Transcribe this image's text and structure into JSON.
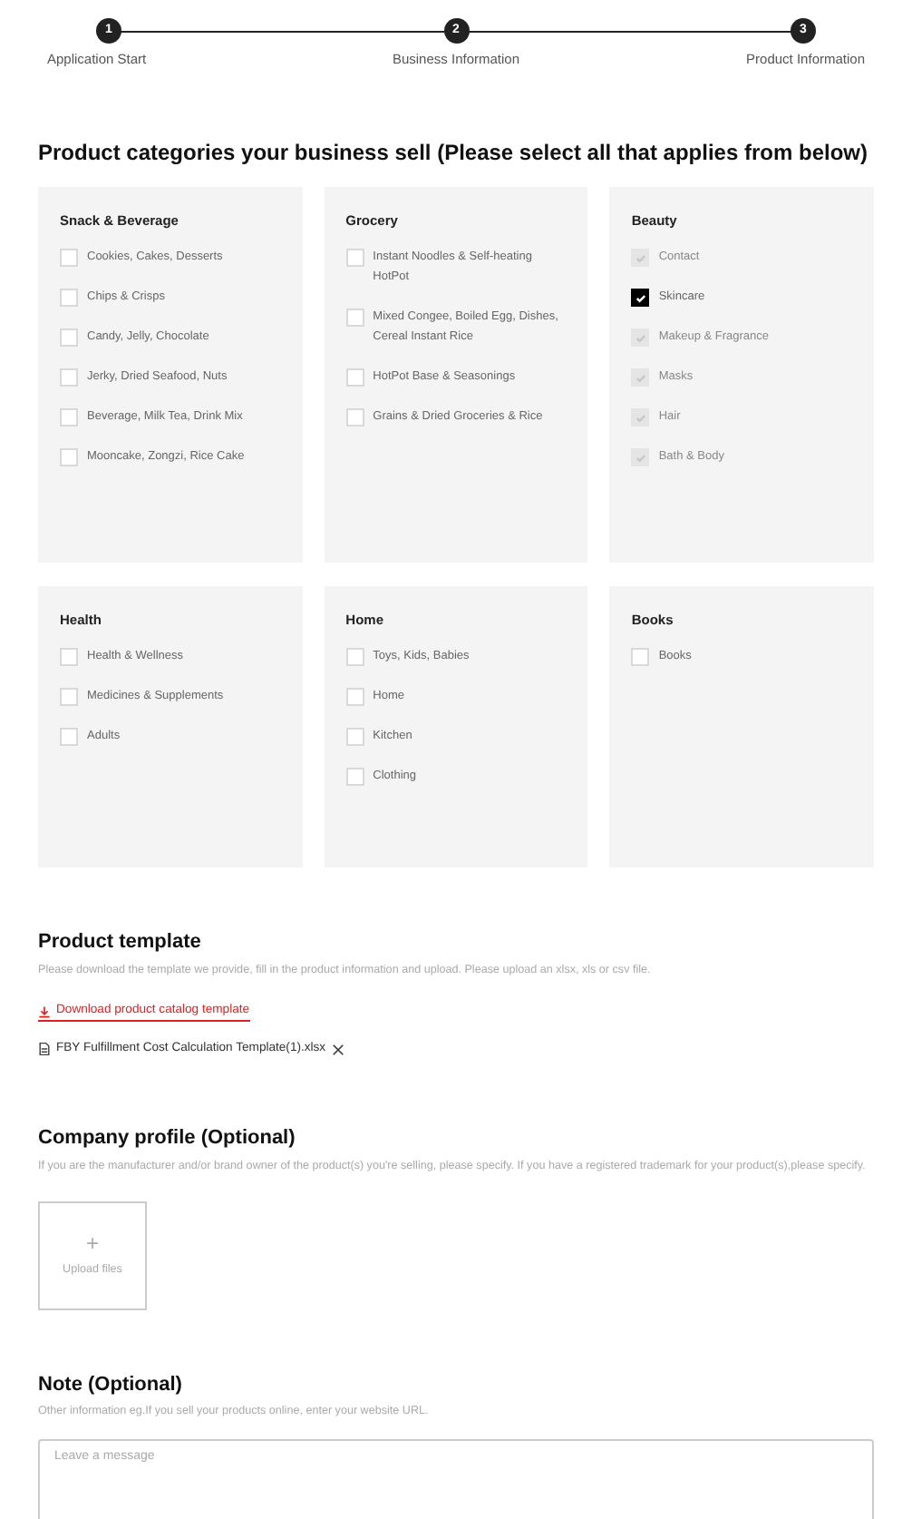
{
  "steps": [
    {
      "number": "1",
      "label": "Application Start"
    },
    {
      "number": "2",
      "label": "Business Information"
    },
    {
      "number": "3",
      "label": "Product Information"
    }
  ],
  "categories": {
    "title": "Product categories your business sell (Please select all that applies from below)",
    "groups": [
      {
        "title": "Snack & Beverage",
        "items": [
          {
            "label": "Cookies, Cakes, Desserts",
            "checked": false,
            "disabled": false
          },
          {
            "label": "Chips & Crisps",
            "checked": false,
            "disabled": false
          },
          {
            "label": "Candy, Jelly, Chocolate",
            "checked": false,
            "disabled": false
          },
          {
            "label": "Jerky, Dried Seafood, Nuts",
            "checked": false,
            "disabled": false
          },
          {
            "label": "Beverage, Milk Tea, Drink Mix",
            "checked": false,
            "disabled": false
          },
          {
            "label": "Mooncake, Zongzi, Rice Cake",
            "checked": false,
            "disabled": false
          }
        ]
      },
      {
        "title": "Grocery",
        "items": [
          {
            "label": "Instant Noodles & Self-heating HotPot",
            "checked": false,
            "disabled": false
          },
          {
            "label": "Mixed Congee, Boiled Egg, Dishes, Cereal Instant Rice",
            "checked": false,
            "disabled": false
          },
          {
            "label": "HotPot Base & Seasonings",
            "checked": false,
            "disabled": false
          },
          {
            "label": "Grains & Dried Groceries & Rice",
            "checked": false,
            "disabled": false
          }
        ]
      },
      {
        "title": "Beauty",
        "items": [
          {
            "label": "Contact",
            "checked": true,
            "disabled": true
          },
          {
            "label": "Skincare",
            "checked": true,
            "disabled": false
          },
          {
            "label": "Makeup & Fragrance",
            "checked": true,
            "disabled": true
          },
          {
            "label": "Masks",
            "checked": true,
            "disabled": true
          },
          {
            "label": "Hair",
            "checked": true,
            "disabled": true
          },
          {
            "label": "Bath & Body",
            "checked": true,
            "disabled": true
          }
        ]
      },
      {
        "title": "Health",
        "items": [
          {
            "label": "Health & Wellness",
            "checked": false,
            "disabled": false
          },
          {
            "label": "Medicines & Supplements",
            "checked": false,
            "disabled": false
          },
          {
            "label": "Adults",
            "checked": false,
            "disabled": false
          }
        ]
      },
      {
        "title": "Home",
        "items": [
          {
            "label": "Toys, Kids, Babies",
            "checked": false,
            "disabled": false
          },
          {
            "label": "Home",
            "checked": false,
            "disabled": false
          },
          {
            "label": "Kitchen",
            "checked": false,
            "disabled": false
          },
          {
            "label": "Clothing",
            "checked": false,
            "disabled": false
          }
        ]
      },
      {
        "title": "Books",
        "items": [
          {
            "label": "Books",
            "checked": false,
            "disabled": false
          }
        ]
      }
    ]
  },
  "product_template": {
    "title": "Product template",
    "description": "Please download the template we provide, fill in the product information and upload. Please upload an xlsx, xls or csv file.",
    "download_link": "Download product catalog template",
    "file": "FBY Fulfillment Cost Calculation Template(1).xlsx"
  },
  "company_profile": {
    "title": "Company profile (Optional)",
    "description": "If you are the manufacturer and/or brand owner of the product(s) you're selling, please specify. If you have a registered trademark for your product(s),please specify.",
    "upload_label": "Upload files",
    "upload_icon": "+"
  },
  "note": {
    "title": "Note (Optional)",
    "description": "Other information eg.If you sell your products online, enter your website URL.",
    "placeholder": "Leave a message"
  }
}
